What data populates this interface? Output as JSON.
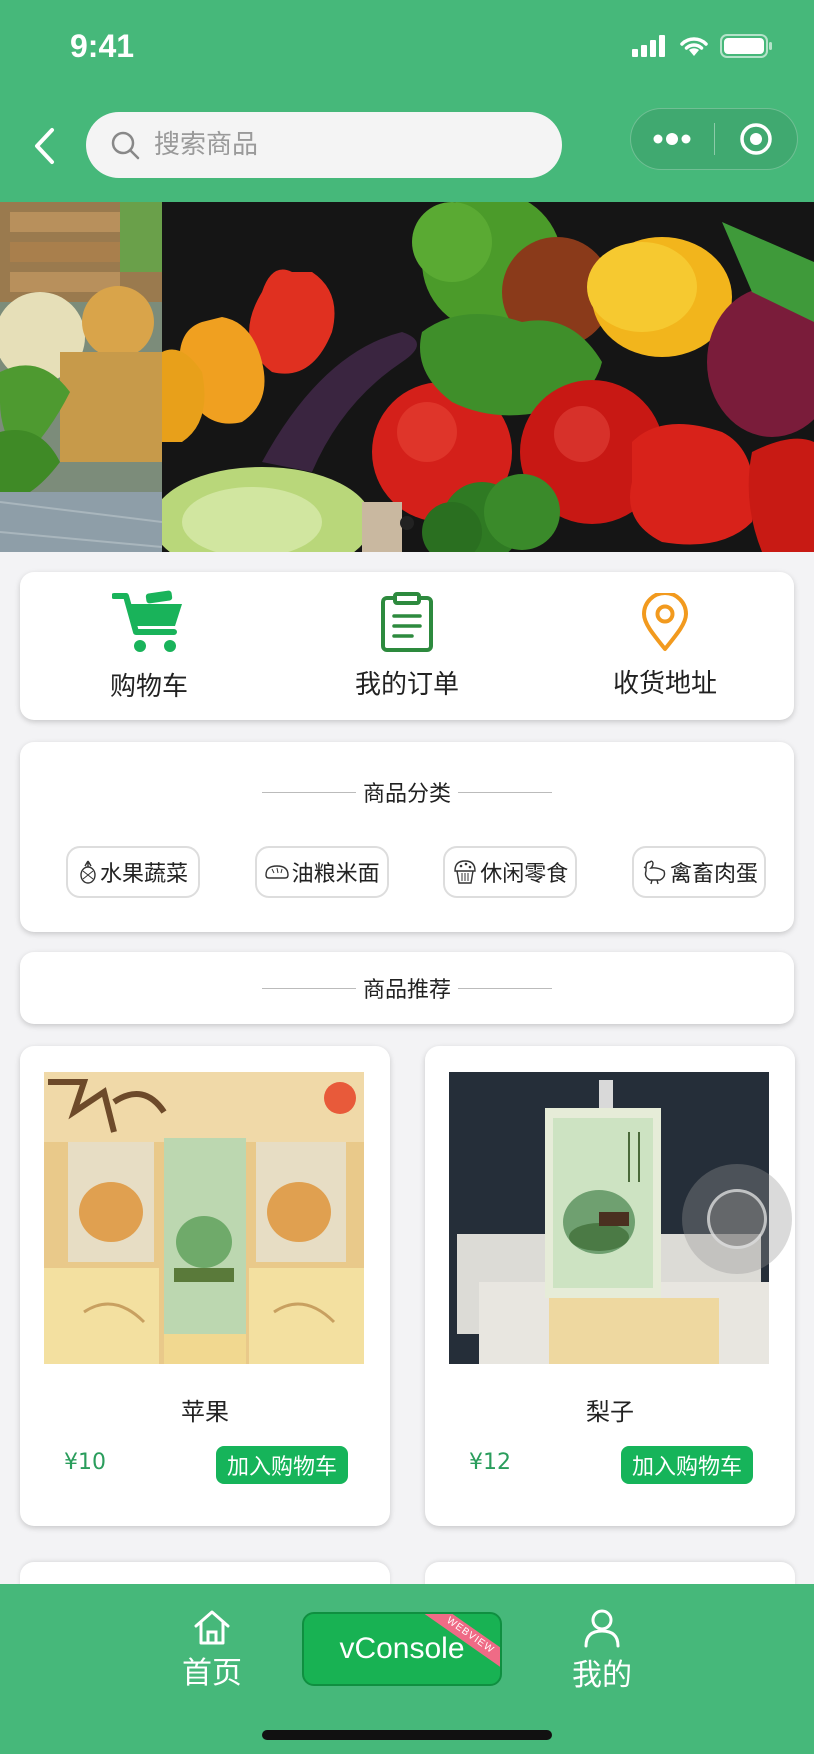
{
  "status_bar": {
    "time": "9:41"
  },
  "nav": {
    "search_placeholder": "搜索商品"
  },
  "quick_links": [
    {
      "label": "购物车",
      "icon": "cart-icon",
      "color": "#19b35a"
    },
    {
      "label": "我的订单",
      "icon": "order-clipboard-icon",
      "color": "#2d8a3e"
    },
    {
      "label": "收货地址",
      "icon": "location-pin-icon",
      "color": "#f29a1e"
    }
  ],
  "categories": {
    "title": "商品分类",
    "items": [
      {
        "label": "水果蔬菜",
        "icon": "pineapple-icon"
      },
      {
        "label": "油粮米面",
        "icon": "bread-icon"
      },
      {
        "label": "休闲零食",
        "icon": "muffin-icon"
      },
      {
        "label": "禽畜肉蛋",
        "icon": "chicken-icon"
      }
    ]
  },
  "recommend": {
    "title": "商品推荐"
  },
  "products": [
    {
      "name": "苹果",
      "price": "¥10",
      "add_label": "加入购物车"
    },
    {
      "name": "梨子",
      "price": "¥12",
      "add_label": "加入购物车"
    }
  ],
  "tabbar": {
    "home_label": "首页",
    "mine_label": "我的",
    "vconsole_label": "vConsole",
    "vconsole_ribbon": "WEBVIEW"
  },
  "colors": {
    "primary": "#46b87a",
    "button": "#16b45a",
    "price": "#2a9d5c"
  }
}
